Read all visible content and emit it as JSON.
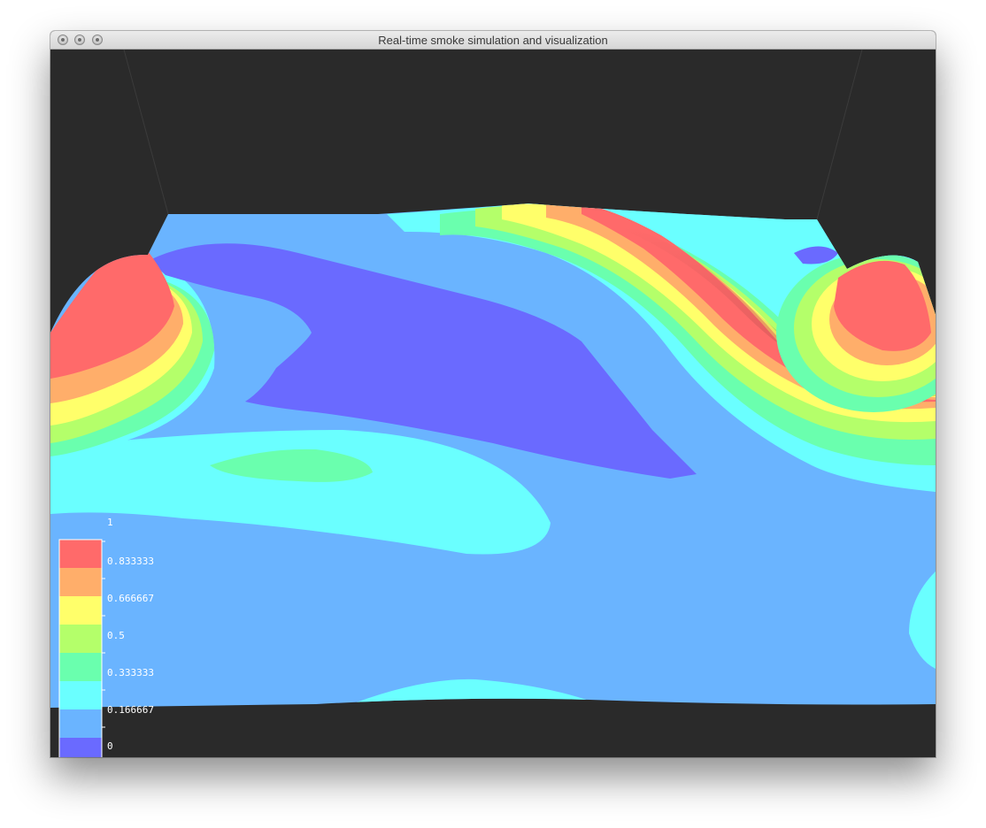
{
  "window": {
    "title": "Real-time smoke simulation and visualization"
  },
  "legend": {
    "labels": [
      "1",
      "0.833333",
      "0.666667",
      "0.5",
      "0.333333",
      "0.166667",
      "0"
    ],
    "colors": [
      "#ff6a6a",
      "#ffae6a",
      "#ffff6a",
      "#b4ff6a",
      "#6affae",
      "#6affff",
      "#6ab4ff",
      "#6a6aff"
    ]
  },
  "colors": {
    "background": "#2a2a2a"
  }
}
